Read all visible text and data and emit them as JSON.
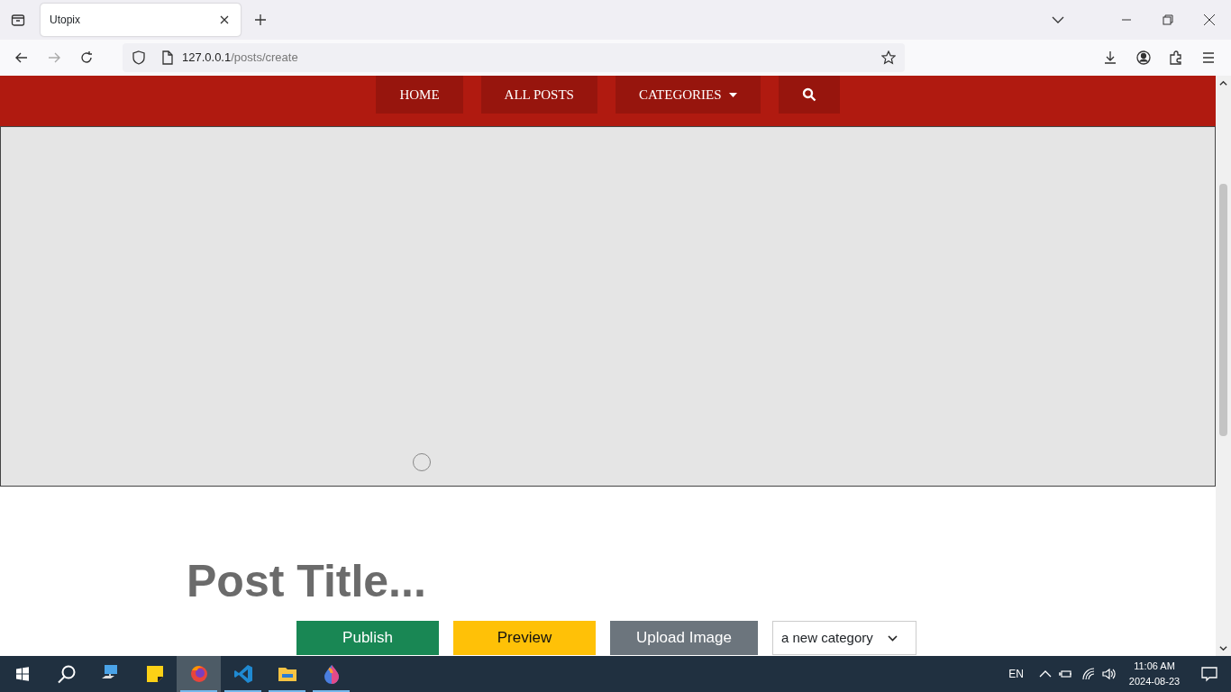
{
  "browser": {
    "tabs": [
      {
        "title": "Utopix",
        "selected": true
      }
    ],
    "address": {
      "host": "127.0.0.1",
      "path": "/posts/create"
    }
  },
  "navbar": {
    "items": [
      {
        "label": "HOME",
        "kind": "link"
      },
      {
        "label": "ALL POSTS",
        "kind": "link"
      },
      {
        "label": "CATEGORIES",
        "kind": "dropdown"
      },
      {
        "kind": "search"
      }
    ]
  },
  "editor": {
    "title_placeholder": "Post Title...",
    "buttons": [
      {
        "label": "Publish",
        "kind": "success"
      },
      {
        "label": "Preview",
        "kind": "warning"
      },
      {
        "label": "Upload Image",
        "kind": "secondary"
      }
    ],
    "category": {
      "value": "a new category"
    }
  },
  "taskbar": {
    "apps": [
      {
        "kind": "computer",
        "active": false,
        "open": false
      },
      {
        "kind": "notes",
        "active": false,
        "open": false
      },
      {
        "kind": "firefox",
        "active": true,
        "open": true
      },
      {
        "kind": "vscode",
        "active": false,
        "open": true
      },
      {
        "kind": "folder",
        "active": false,
        "open": true
      },
      {
        "kind": "drop",
        "active": false,
        "open": true
      }
    ],
    "language": "EN",
    "time": "11:06 AM",
    "date": "2024-08-23"
  }
}
